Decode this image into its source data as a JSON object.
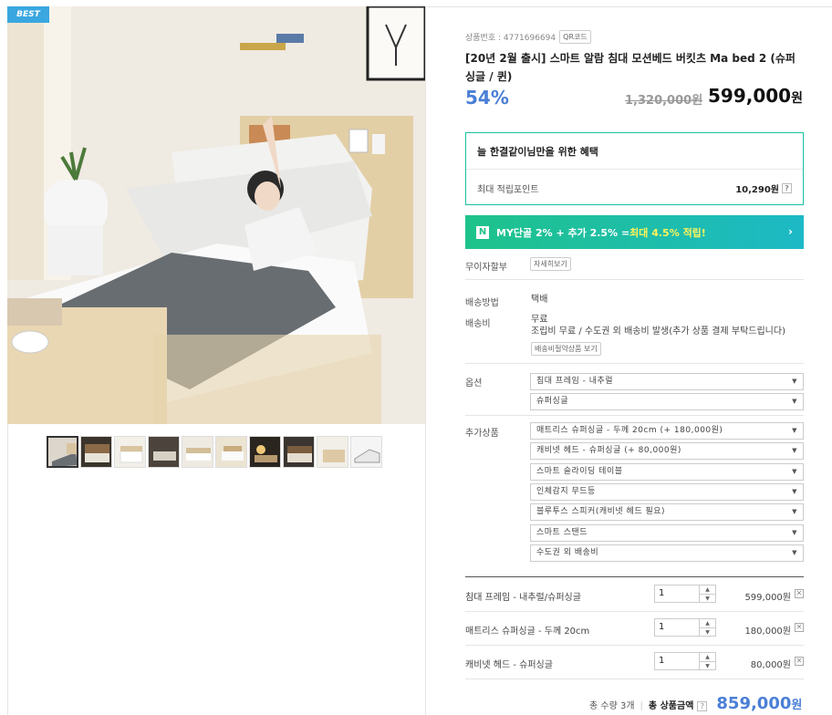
{
  "badge": "BEST",
  "product": {
    "code_label": "상품번호 : 4771696694",
    "qr_label": "QR코드",
    "title": "[20년 2월 출시] 스마트 알람 침대 모션베드 버킷츠 Ma bed 2 (슈퍼싱글 / 퀸)",
    "discount": "54%",
    "original_price": "1,320,000원",
    "sale_price": "599,000",
    "sale_won": "원"
  },
  "benefit": {
    "title": "늘 한결같이님만을 위한 혜택",
    "label": "최대 적립포인트",
    "value": "10,290원",
    "help": "?"
  },
  "naver_banner": {
    "logo": "N",
    "text_prefix": "MY단골 2% + 추가 2.5% = ",
    "text_highlight": "최대 4.5% 적립!",
    "arrow": "›"
  },
  "installment": {
    "label": "무이자할부",
    "button": "자세히보기"
  },
  "shipping": {
    "method_label": "배송방법",
    "method_value": "택배",
    "fee_label": "배송비",
    "fee_value": "무료",
    "fee_note": "조립비 무료 / 수도권 외 배송비 발생(추가 상품 결제 부탁드립니다)",
    "bundle_button": "배송비절약상품 보기"
  },
  "options": {
    "label": "옵션",
    "selects": [
      "침대 프레임 - 내추럴",
      "슈퍼싱글"
    ]
  },
  "extras": {
    "label": "추가상품",
    "selects": [
      "매트리스 슈퍼싱글 - 두께 20cm (+ 180,000원)",
      "캐비넷 헤드 - 슈퍼싱글 (+ 80,000원)",
      "스마트 슬라이딩 테이블",
      "인체감지 무드등",
      "블루투스 스피커(캐비넷 헤드 필요)",
      "스마트 스탠드",
      "수도권 외 배송비"
    ]
  },
  "selected_items": [
    {
      "name": "침대 프레임 - 내추럴/슈퍼싱글",
      "qty": "1",
      "price": "599,000원"
    },
    {
      "name": "매트리스 슈퍼싱글 - 두께 20cm",
      "qty": "1",
      "price": "180,000원"
    },
    {
      "name": "캐비넷 헤드 - 슈퍼싱글",
      "qty": "1",
      "price": "80,000원"
    }
  ],
  "total": {
    "qty_label": "총 수량 3개",
    "amount_label": "총 상품금액",
    "help": "?",
    "amount": "859,000",
    "won": "원"
  }
}
